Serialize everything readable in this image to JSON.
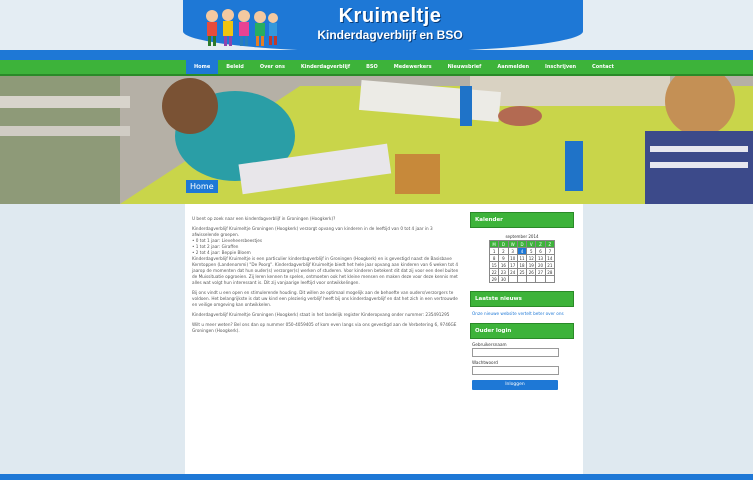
{
  "header": {
    "title": "Kruimeltje",
    "subtitle": "Kinderdagverblijf en BSO"
  },
  "nav": {
    "items": [
      "Home",
      "Beleid",
      "Over ons",
      "Kinderdagverblijf",
      "BSO",
      "Medewerkers",
      "Nieuwsbrief",
      "Aanmelden",
      "Inschrijven",
      "Contact"
    ]
  },
  "banner": {
    "label": "Home"
  },
  "main": {
    "paragraphs": [
      "U bent op zoek naar een kinderdagverblijf in Groningen (Hoogkerk)?",
      "Kinderdagverblijf Kruimeltje Groningen (Hoogkerk) verzorgt opvang van kinderen in de leeftijd van 0 tot 4 jaar in 3 afwisselende groepen.",
      "• 0 tot 1 jaar: Lieveheersbeestjes",
      "• 1 tot 2 jaar: Giraffen",
      "• 2 tot 4 jaar: Beppie Bloem",
      "Kinderdagverblijf Kruimeltje is een particulier kinderdagverblijf in Groningen (Hoogkerk) en is gevestigd naast de Basisbave Kerntoppen (Landenommi) \"De Poorg\". Kinderdagverblijf Kruimeltje biedt het hele jaar opvang aan kinderen van 6 weken tot 4 jaarop de momenten dat hun ouder(s) verzorger(s) werken of studeren. Voor kinderen betekent dit dat zij voor een deel buiten de Muissituatie opgroeien. Zij leren kennen te spelen, ontmoeten ook het kleine mensen en maken deze voor deze kennis met alles wat volgt hun interessant is. Dit zij vanjaarige leeftijd voor ontwikkelingen.",
      "Bij ons vindt u een open en stimulerende houding. Dit willen ze optimaal mogelijk aan de behoefte van ouders/verzorgers te voldoen. Het belangrijkste is dat uw kind een plezierig verblijf heeft bij ons kinderdagverblijf en dat het zich in een vertrouwde en veilige omgeving kan ontwikkelen.",
      "Kinderdagverblijf Kruimeltje Groningen (Hoogkerk) staat in het landelijk register Kinderopvang onder nummer: 235491295",
      "Wilt u meer weten? Bel ons dan op nummer 050-4059405 of kom even langs via ons gevestigd aan de Verbetering 6, 9746GE Groningen (Hoogkerk)."
    ]
  },
  "sidebar": {
    "calendar": {
      "heading": "Kalender",
      "month": "september 2014",
      "weekdays": [
        "M",
        "D",
        "W",
        "D",
        "V",
        "Z",
        "Z"
      ],
      "weeks": [
        [
          "1",
          "2",
          "3",
          "4",
          "5",
          "6",
          "7"
        ],
        [
          "8",
          "9",
          "10",
          "11",
          "12",
          "13",
          "14"
        ],
        [
          "15",
          "16",
          "17",
          "18",
          "19",
          "20",
          "21"
        ],
        [
          "22",
          "23",
          "24",
          "25",
          "26",
          "27",
          "28"
        ],
        [
          "29",
          "30",
          "",
          "",
          "",
          "",
          ""
        ]
      ],
      "today": "4"
    },
    "news": {
      "heading": "Laatste nieuws",
      "items": [
        "Onze nieuwe website vertelt beter over ons"
      ]
    },
    "login": {
      "heading": "Ouder login",
      "username_label": "Gebruikersnaam",
      "password_label": "Wachtwoord",
      "submit_label": "Inloggen"
    }
  },
  "colors": {
    "brand_blue": "#1e78d6",
    "brand_green": "#3db33a"
  }
}
